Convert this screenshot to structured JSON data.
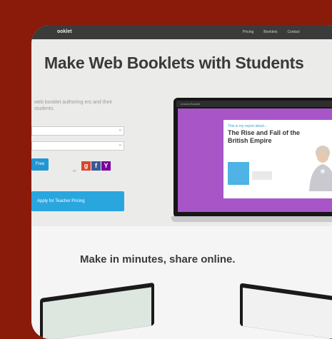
{
  "navbar": {
    "brand": "ooklet",
    "links": [
      "Pricing",
      "Booklets",
      "Contact"
    ]
  },
  "hero": {
    "title": "Make Web Booklets with Students",
    "subtitle": "web booklet authoring ers and their students.",
    "try_button": "Free",
    "or_text": "or",
    "pricing_button": "Apply for Teacher Pricing"
  },
  "screen": {
    "app_name": "Lesson Booklet",
    "slide_pretitle": "This is my report about...",
    "slide_title": "The Rise and Fall of the British Empire"
  },
  "section": {
    "title": "Make in minutes, share online."
  },
  "colors": {
    "background": "#8a1a0a",
    "accent_blue": "#2aa6df",
    "slide_purple": "#a855c8",
    "google": "#d9472b",
    "facebook": "#3b5998",
    "yahoo": "#7b0099"
  },
  "icons": [
    "google-plus-icon",
    "facebook-icon",
    "yahoo-icon",
    "dropdown-chevron-icon"
  ]
}
